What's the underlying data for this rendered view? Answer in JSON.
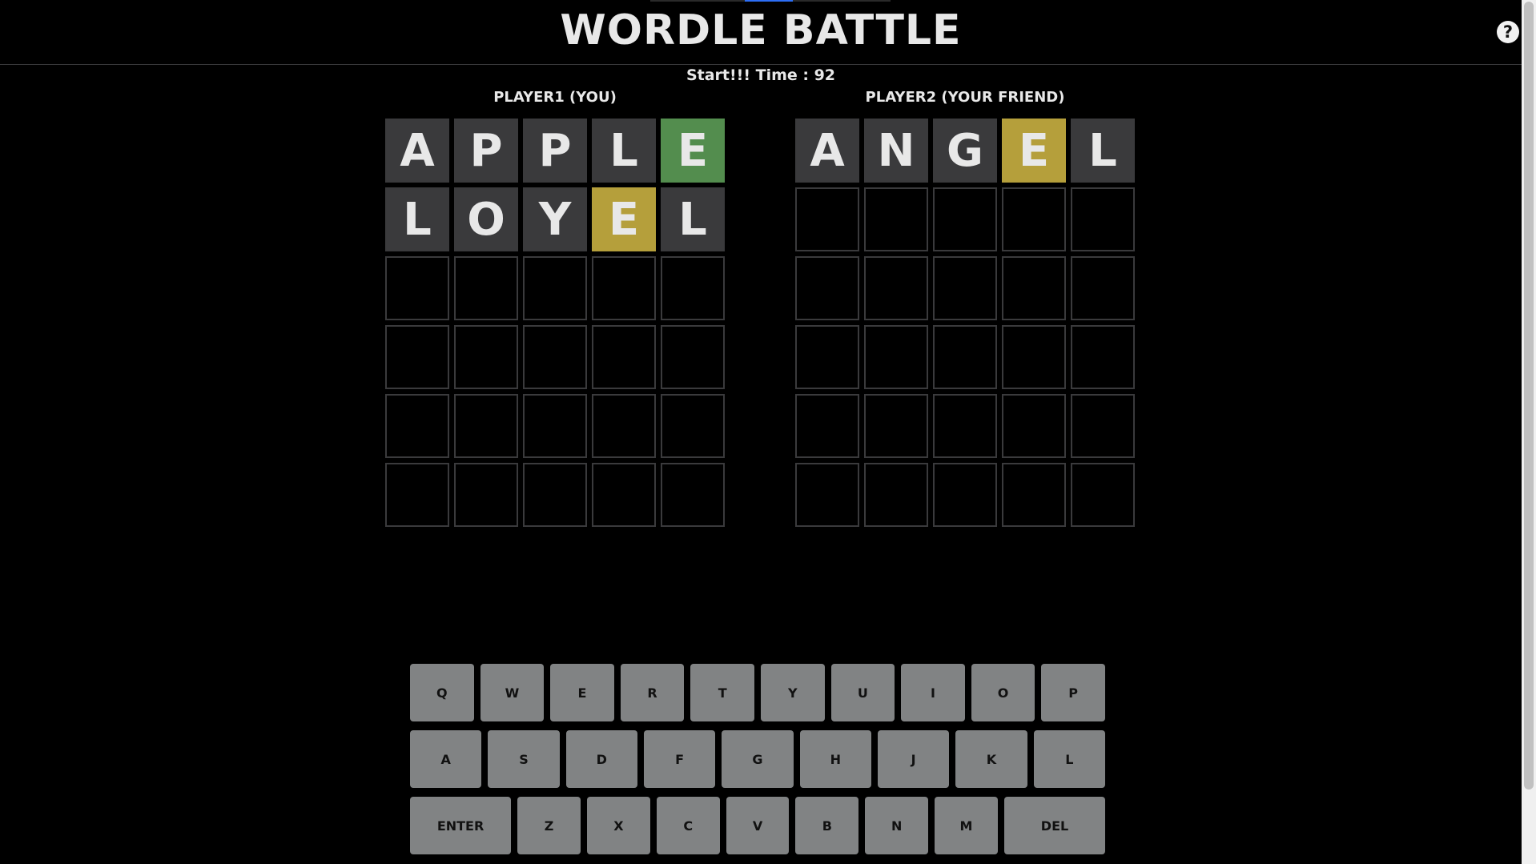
{
  "header": {
    "title": "WORDLE BATTLE",
    "help_label": "?"
  },
  "status": {
    "timer_text": "Start!!! Time : 92"
  },
  "players": [
    {
      "label": "PLAYER1 (YOU)",
      "rows": [
        [
          {
            "l": "A",
            "s": "absent"
          },
          {
            "l": "P",
            "s": "absent"
          },
          {
            "l": "P",
            "s": "absent"
          },
          {
            "l": "L",
            "s": "absent"
          },
          {
            "l": "E",
            "s": "correct"
          }
        ],
        [
          {
            "l": "L",
            "s": "absent"
          },
          {
            "l": "O",
            "s": "absent"
          },
          {
            "l": "Y",
            "s": "absent"
          },
          {
            "l": "E",
            "s": "present"
          },
          {
            "l": "L",
            "s": "absent"
          }
        ],
        [],
        [],
        [],
        []
      ]
    },
    {
      "label": "PLAYER2 (YOUR FRIEND)",
      "rows": [
        [
          {
            "l": "A",
            "s": "absent"
          },
          {
            "l": "N",
            "s": "absent"
          },
          {
            "l": "G",
            "s": "absent"
          },
          {
            "l": "E",
            "s": "present"
          },
          {
            "l": "L",
            "s": "absent"
          }
        ],
        [],
        [],
        [],
        [],
        []
      ]
    }
  ],
  "keyboard": {
    "row1": [
      "Q",
      "W",
      "E",
      "R",
      "T",
      "Y",
      "U",
      "I",
      "O",
      "P"
    ],
    "row2": [
      "A",
      "S",
      "D",
      "F",
      "G",
      "H",
      "J",
      "K",
      "L"
    ],
    "row3": [
      "ENTER",
      "Z",
      "X",
      "C",
      "V",
      "B",
      "N",
      "M",
      "DEL"
    ]
  },
  "colors": {
    "correct": "#538d4e",
    "present": "#b59f3b",
    "absent": "#3a3a3c",
    "key": "#818384"
  }
}
